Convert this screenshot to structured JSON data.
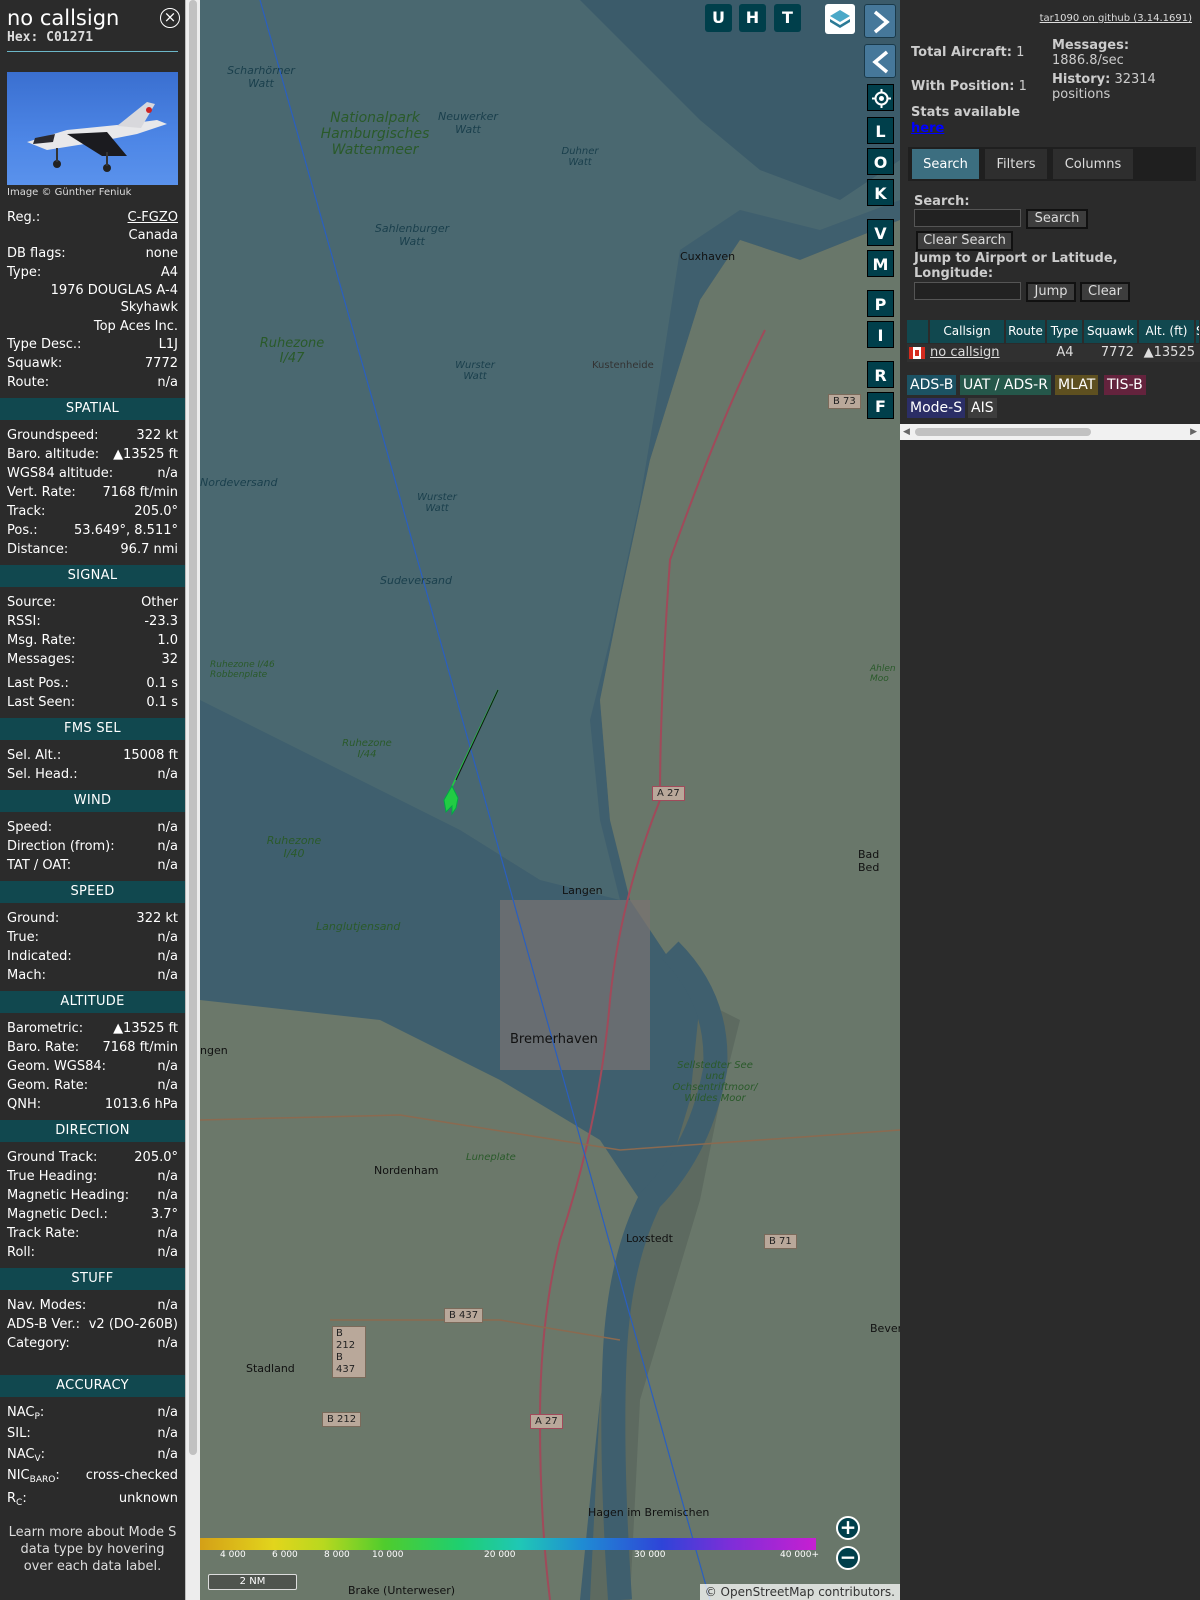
{
  "panel": {
    "callsign": "no callsign",
    "hex_label": "Hex:",
    "hex": "C01271",
    "photo_credit": "Image © Günther Feniuk",
    "reg_label": "Reg.:",
    "reg": "C-FGZO",
    "country": "Canada",
    "dbflags_label": "DB flags:",
    "dbflags": "none",
    "type_label": "Type:",
    "type": "A4",
    "model_line1": "1976 DOUGLAS A-4",
    "model_line2": "Skyhawk",
    "operator": "Top Aces Inc.",
    "typedesc_label": "Type Desc.:",
    "typedesc": "L1J",
    "squawk_label": "Squawk:",
    "squawk": "7772",
    "route_label": "Route:",
    "route": "n/a",
    "sections": {
      "spatial": "SPATIAL",
      "signal": "SIGNAL",
      "fms": "FMS SEL",
      "wind": "WIND",
      "speed": "SPEED",
      "altitude": "ALTITUDE",
      "direction": "DIRECTION",
      "stuff": "STUFF",
      "accuracy": "ACCURACY"
    },
    "spatial": [
      {
        "k": "Groundspeed:",
        "v": "322 kt"
      },
      {
        "k": "Baro. altitude:",
        "v": "▲13525 ft"
      },
      {
        "k": "WGS84 altitude:",
        "v": "n/a"
      },
      {
        "k": "Vert. Rate:",
        "v": "7168 ft/min"
      },
      {
        "k": "Track:",
        "v": "205.0°"
      },
      {
        "k": "Pos.:",
        "v": "53.649°, 8.511°"
      },
      {
        "k": "Distance:",
        "v": "96.7 nmi"
      }
    ],
    "signal": [
      {
        "k": "Source:",
        "v": "Other"
      },
      {
        "k": "RSSI:",
        "v": "-23.3"
      },
      {
        "k": "Msg. Rate:",
        "v": "1.0"
      },
      {
        "k": "Messages:",
        "v": "32"
      }
    ],
    "signal2": [
      {
        "k": "Last Pos.:",
        "v": "0.1 s"
      },
      {
        "k": "Last Seen:",
        "v": "0.1 s"
      }
    ],
    "fms": [
      {
        "k": "Sel. Alt.:",
        "v": "15008 ft"
      },
      {
        "k": "Sel. Head.:",
        "v": "n/a"
      }
    ],
    "wind": [
      {
        "k": "Speed:",
        "v": "n/a"
      },
      {
        "k": "Direction (from):",
        "v": "n/a"
      },
      {
        "k": "TAT / OAT:",
        "v": "n/a"
      }
    ],
    "speed": [
      {
        "k": "Ground:",
        "v": "322 kt"
      },
      {
        "k": "True:",
        "v": "n/a"
      },
      {
        "k": "Indicated:",
        "v": "n/a"
      },
      {
        "k": "Mach:",
        "v": "n/a"
      }
    ],
    "altitude": [
      {
        "k": "Barometric:",
        "v": "▲13525 ft"
      },
      {
        "k": "Baro. Rate:",
        "v": "7168 ft/min"
      },
      {
        "k": "Geom. WGS84:",
        "v": "n/a"
      },
      {
        "k": "Geom. Rate:",
        "v": "n/a"
      },
      {
        "k": "QNH:",
        "v": "1013.6 hPa"
      }
    ],
    "direction": [
      {
        "k": "Ground Track:",
        "v": "205.0°"
      },
      {
        "k": "True Heading:",
        "v": "n/a"
      },
      {
        "k": "Magnetic Heading:",
        "v": "n/a"
      },
      {
        "k": "Magnetic Decl.:",
        "v": "3.7°"
      },
      {
        "k": "Track Rate:",
        "v": "n/a"
      },
      {
        "k": "Roll:",
        "v": "n/a"
      }
    ],
    "stuff": [
      {
        "k": "Nav. Modes:",
        "v": "n/a"
      },
      {
        "k": "ADS-B Ver.:",
        "v": "v2 (DO-260B)"
      },
      {
        "k": "Category:",
        "v": "n/a"
      }
    ],
    "accuracy": {
      "nacp_k": "NAC",
      "nacp_sub": "P",
      "nacp_v": "n/a",
      "sil_k": "SIL:",
      "sil_v": "n/a",
      "nacv_k": "NAC",
      "nacv_sub": "V",
      "nacv_v": "n/a",
      "nicbaro_k": "NIC",
      "nicbaro_sub": "BARO",
      "nicbaro_v": "cross-checked",
      "rc_k": "R",
      "rc_sub": "C",
      "rc_v": "unknown"
    },
    "learn_more": "Learn more about Mode S data type by hovering over each data label."
  },
  "map": {
    "place_labels": [
      "Scharhörner Watt",
      "Nationalpark Hamburgisches Wattenmeer",
      "Neuwerker Watt",
      "Duhner Watt",
      "Sahlenburger Watt",
      "Cuxhaven",
      "Ruhezone I/47",
      "Wurster Watt",
      "Kustenheide",
      "Nordeversand",
      "Wurster Watt",
      "Sudeversand",
      "Ruhezone I/46 Robbenplate",
      "Ruhezone I/44",
      "Ruhezone I/40",
      "Langlutjensand",
      "Langen",
      "Bremerhaven",
      "Sellstedter See und Ochsentriftmoor/ Wildes Moor",
      "Nordenham",
      "Luneplate",
      "Loxstedt",
      "Stadland",
      "Hagen im Bremischen",
      "Brake (Unterweser)",
      "Bad Bed",
      "Bevers",
      "ngen",
      "Ahlen Moo"
    ],
    "road_badges": [
      "B 73",
      "A 27",
      "B 71",
      "B 437",
      "B 212 B 437",
      "B 212",
      "A 27"
    ],
    "top_buttons": [
      "U",
      "H",
      "T"
    ],
    "side_buttons": [
      "L",
      "O",
      "K",
      "V",
      "M",
      "P",
      "I",
      "R",
      "F"
    ],
    "altitude_ticks": [
      "4 000",
      "6 000",
      "8 000",
      "10 000",
      "20 000",
      "30 000",
      "40 000+"
    ],
    "scale_label": "2 NM",
    "attribution": "© OpenStreetMap contributors."
  },
  "right": {
    "github_link": "tar1090 on github (3.14.1691)",
    "total_label": "Total Aircraft:",
    "total_value": "1",
    "withpos_label": "With Position:",
    "withpos_value": "1",
    "stats_label": "Stats available",
    "stats_link": "here",
    "messages_label": "Messages:",
    "messages_value": "1886.8/sec",
    "history_label": "History:",
    "history_value": "32314",
    "history_unit": "positions",
    "tabs": [
      "Search",
      "Filters",
      "Columns"
    ],
    "search_label": "Search:",
    "search_button": "Search",
    "clear_search": "Clear Search",
    "jump_label": "Jump to Airport or Latitude, Longitude:",
    "jump_button": "Jump",
    "clear_button": "Clear",
    "table_headers": [
      "Callsign",
      "Route",
      "Type",
      "Squawk",
      "Alt. (ft)",
      "S"
    ],
    "table_row": {
      "callsign": "no callsign",
      "route": "",
      "type": "A4",
      "squawk": "7772",
      "alt": "▲13525"
    },
    "source_badges": [
      {
        "label": "ADS-B",
        "color": "#1c5263"
      },
      {
        "label": "UAT / ADS-R",
        "color": "#25574a"
      },
      {
        "label": "MLAT",
        "color": "#5e5020"
      },
      {
        "label": "TIS-B",
        "color": "#64233d"
      },
      {
        "label": "Mode-S",
        "color": "#2b2e66"
      },
      {
        "label": "AIS",
        "color": "#3d3d3d"
      }
    ]
  },
  "colors": {
    "accent": "#11484f",
    "button": "#003f4b",
    "track": "#22cc44"
  }
}
